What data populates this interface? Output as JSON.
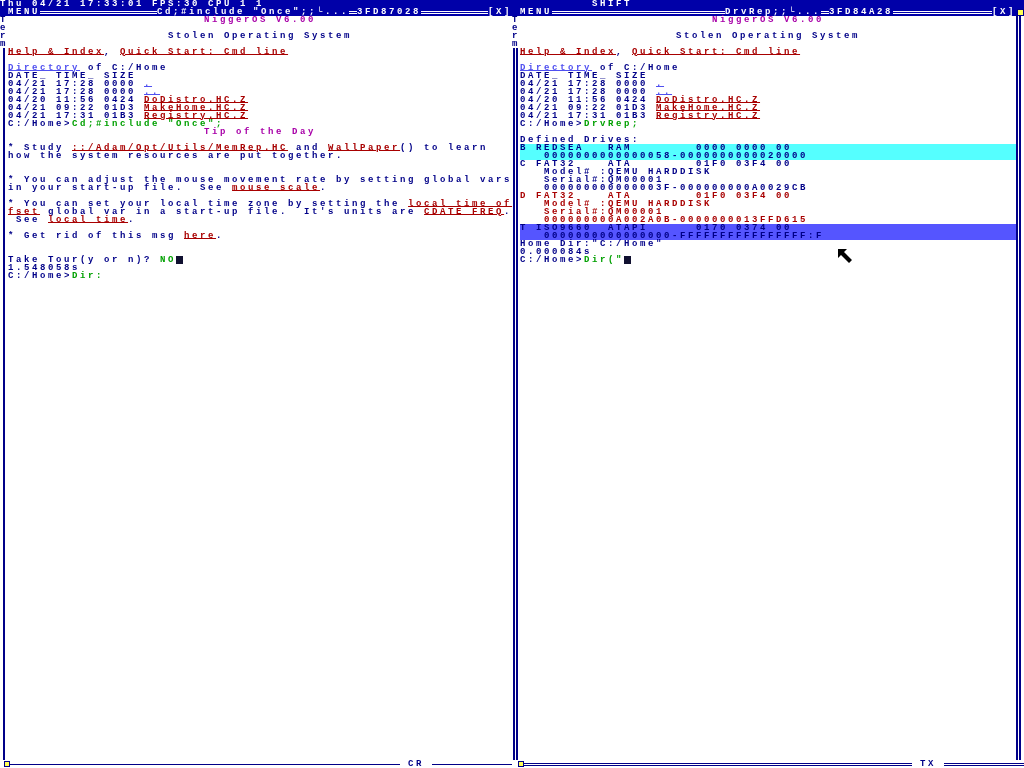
{
  "status_bar": {
    "text": "Thu 04/21 17:33:01 FPS:30 CPU 1 1",
    "modifier": "SHIFT"
  },
  "windows": [
    {
      "focused": false,
      "menu": "MENU",
      "title": "Cd;#include \"Once\";;└...",
      "address": "3FD87028",
      "close": "[X]",
      "task": "Term",
      "footer": "CR",
      "lines": [
        {
          "kind": "title",
          "text": "NiggerOS V6.00"
        },
        {
          "kind": "blank"
        },
        {
          "kind": "subtitle",
          "text": "Stolen Operating System"
        },
        {
          "kind": "blank"
        },
        {
          "kind": "text",
          "segments": [
            {
              "kind": "link",
              "text": "Help & Index"
            },
            {
              "kind": "plain",
              "text": ", "
            },
            {
              "kind": "link",
              "text": "Quick Start: Cmd line"
            }
          ]
        },
        {
          "kind": "blank"
        },
        {
          "kind": "text",
          "segments": [
            {
              "kind": "dir_link",
              "text": "Directory"
            },
            {
              "kind": "plain",
              "text": " of C:/Home"
            }
          ]
        },
        {
          "kind": "text",
          "text": "DATE_ TIME_ SIZE"
        },
        {
          "kind": "text",
          "segments": [
            {
              "kind": "plain",
              "text": "04/21 17:28 0000 "
            },
            {
              "kind": "dir_link",
              "text": "."
            }
          ]
        },
        {
          "kind": "text",
          "segments": [
            {
              "kind": "plain",
              "text": "04/21 17:28 0000 "
            },
            {
              "kind": "dir_link",
              "text": ".."
            }
          ]
        },
        {
          "kind": "text",
          "segments": [
            {
              "kind": "plain",
              "text": "04/20 11:56 0424 "
            },
            {
              "kind": "link",
              "text": "DoDistro.HC.Z"
            }
          ]
        },
        {
          "kind": "text",
          "segments": [
            {
              "kind": "plain",
              "text": "04/21 09:22 01D3 "
            },
            {
              "kind": "link",
              "text": "MakeHome.HC.Z"
            }
          ]
        },
        {
          "kind": "text",
          "segments": [
            {
              "kind": "plain",
              "text": "04/21 17:31 01B3 "
            },
            {
              "kind": "link",
              "text": "Registry.HC.Z"
            }
          ]
        },
        {
          "kind": "text",
          "segments": [
            {
              "kind": "plain",
              "text": "C:/Home>"
            },
            {
              "kind": "command",
              "text": "Cd;#include \"Once\";"
            }
          ]
        },
        {
          "kind": "title",
          "text": "Tip of the Day"
        },
        {
          "kind": "blank"
        },
        {
          "kind": "text",
          "segments": [
            {
              "kind": "plain",
              "text": "* Study "
            },
            {
              "kind": "link",
              "text": "::/Adam/Opt/Utils/MemRep.HC"
            },
            {
              "kind": "plain",
              "text": " and "
            },
            {
              "kind": "link",
              "text": "WallPaper"
            },
            {
              "kind": "plain",
              "text": "() to learn"
            }
          ]
        },
        {
          "kind": "text",
          "text": "how the system resources are put together."
        },
        {
          "kind": "blank"
        },
        {
          "kind": "blank"
        },
        {
          "kind": "text",
          "text": "* You can adjust the mouse movement rate by setting global vars"
        },
        {
          "kind": "text",
          "segments": [
            {
              "kind": "plain",
              "text": "in your start-up file.  See "
            },
            {
              "kind": "link",
              "text": "mouse scale"
            },
            {
              "kind": "plain",
              "text": "."
            }
          ]
        },
        {
          "kind": "blank"
        },
        {
          "kind": "text",
          "segments": [
            {
              "kind": "plain",
              "text": "* You can set your local time zone by setting the "
            },
            {
              "kind": "link",
              "text": "local_time_of"
            }
          ]
        },
        {
          "kind": "text",
          "segments": [
            {
              "kind": "link",
              "text": "fset"
            },
            {
              "kind": "plain",
              "text": " global var in a start-up file.  It's units are "
            },
            {
              "kind": "link",
              "text": "CDATE_FREQ"
            },
            {
              "kind": "plain",
              "text": "."
            }
          ]
        },
        {
          "kind": "text",
          "segments": [
            {
              "kind": "plain",
              "text": " See "
            },
            {
              "kind": "link",
              "text": "local time"
            },
            {
              "kind": "plain",
              "text": "."
            }
          ]
        },
        {
          "kind": "blank"
        },
        {
          "kind": "text",
          "segments": [
            {
              "kind": "plain",
              "text": "* Get rid of this msg "
            },
            {
              "kind": "link",
              "text": "here"
            },
            {
              "kind": "plain",
              "text": "."
            }
          ]
        },
        {
          "kind": "blank"
        },
        {
          "kind": "blank"
        },
        {
          "kind": "text",
          "segments": [
            {
              "kind": "plain",
              "text": "Take Tour(y or n)? "
            },
            {
              "kind": "command",
              "text": "NO"
            },
            {
              "kind": "cursor"
            }
          ]
        },
        {
          "kind": "text",
          "text": "1.548058s"
        },
        {
          "kind": "text",
          "segments": [
            {
              "kind": "plain",
              "text": "C:/Home>"
            },
            {
              "kind": "command",
              "text": "Dir:"
            }
          ]
        }
      ]
    },
    {
      "focused": true,
      "menu": "MENU",
      "title": "DrvRep;;└...",
      "address": "3FD84A28",
      "close": "[X]",
      "task": "Term",
      "footer": "TX",
      "lines": [
        {
          "kind": "title",
          "text": "NiggerOS V6.00"
        },
        {
          "kind": "blank"
        },
        {
          "kind": "subtitle",
          "text": "Stolen Operating System"
        },
        {
          "kind": "blank"
        },
        {
          "kind": "text",
          "segments": [
            {
              "kind": "link",
              "text": "Help & Index"
            },
            {
              "kind": "plain",
              "text": ", "
            },
            {
              "kind": "link",
              "text": "Quick Start: Cmd line"
            }
          ]
        },
        {
          "kind": "blank"
        },
        {
          "kind": "text",
          "segments": [
            {
              "kind": "dir_link",
              "text": "Directory"
            },
            {
              "kind": "plain",
              "text": " of C:/Home"
            }
          ]
        },
        {
          "kind": "text",
          "text": "DATE_ TIME_ SIZE"
        },
        {
          "kind": "text",
          "segments": [
            {
              "kind": "plain",
              "text": "04/21 17:28 0000 "
            },
            {
              "kind": "dir_link",
              "text": "."
            }
          ]
        },
        {
          "kind": "text",
          "segments": [
            {
              "kind": "plain",
              "text": "04/21 17:28 0000 "
            },
            {
              "kind": "dir_link",
              "text": ".."
            }
          ]
        },
        {
          "kind": "text",
          "segments": [
            {
              "kind": "plain",
              "text": "04/20 11:56 0424 "
            },
            {
              "kind": "link",
              "text": "DoDistro.HC.Z"
            }
          ]
        },
        {
          "kind": "text",
          "segments": [
            {
              "kind": "plain",
              "text": "04/21 09:22 01D3 "
            },
            {
              "kind": "link",
              "text": "MakeHome.HC.Z"
            }
          ]
        },
        {
          "kind": "text",
          "segments": [
            {
              "kind": "plain",
              "text": "04/21 17:31 01B3 "
            },
            {
              "kind": "link",
              "text": "Registry.HC.Z"
            }
          ]
        },
        {
          "kind": "text",
          "segments": [
            {
              "kind": "plain",
              "text": "C:/Home>"
            },
            {
              "kind": "command",
              "text": "DrvRep;"
            }
          ]
        },
        {
          "kind": "blank"
        },
        {
          "kind": "text",
          "text": "Defined Drives:"
        },
        {
          "kind": "drive_highlighted",
          "color": "#55ffff",
          "lines": [
            "B REDSEA   RAM        0000 0000 00",
            "   0000000000000058-0000000000020000"
          ]
        },
        {
          "kind": "drive",
          "color": "#000088",
          "lines": [
            "C FAT32    ATA        01F0 03F4 00",
            "   Model# :QEMU HARDDISK",
            "   Serial#:QM00001",
            "   000000000000003F-000000000A0029CB"
          ]
        },
        {
          "kind": "drive",
          "color": "#a80000",
          "lines": [
            "D FAT32    ATA        01F0 03F4 00",
            "   Model# :QEMU HARDDISK",
            "   Serial#:QM00001",
            "   000000000A002A0B-0000000013FFD615"
          ]
        },
        {
          "kind": "drive_highlighted",
          "color": "#5555ff",
          "lines": [
            "T ISO9660  ATAPI      0170 0374 00",
            "   0000000000000000-FFFFFFFFFFFFFFFF:F"
          ]
        },
        {
          "kind": "text",
          "text": "Home Dir:\"C:/Home\""
        },
        {
          "kind": "text",
          "text": "0.000084s"
        },
        {
          "kind": "text",
          "segments": [
            {
              "kind": "plain",
              "text": "C:/Home>"
            },
            {
              "kind": "command",
              "text": "Dir(\""
            },
            {
              "kind": "cursor"
            }
          ]
        }
      ]
    }
  ]
}
